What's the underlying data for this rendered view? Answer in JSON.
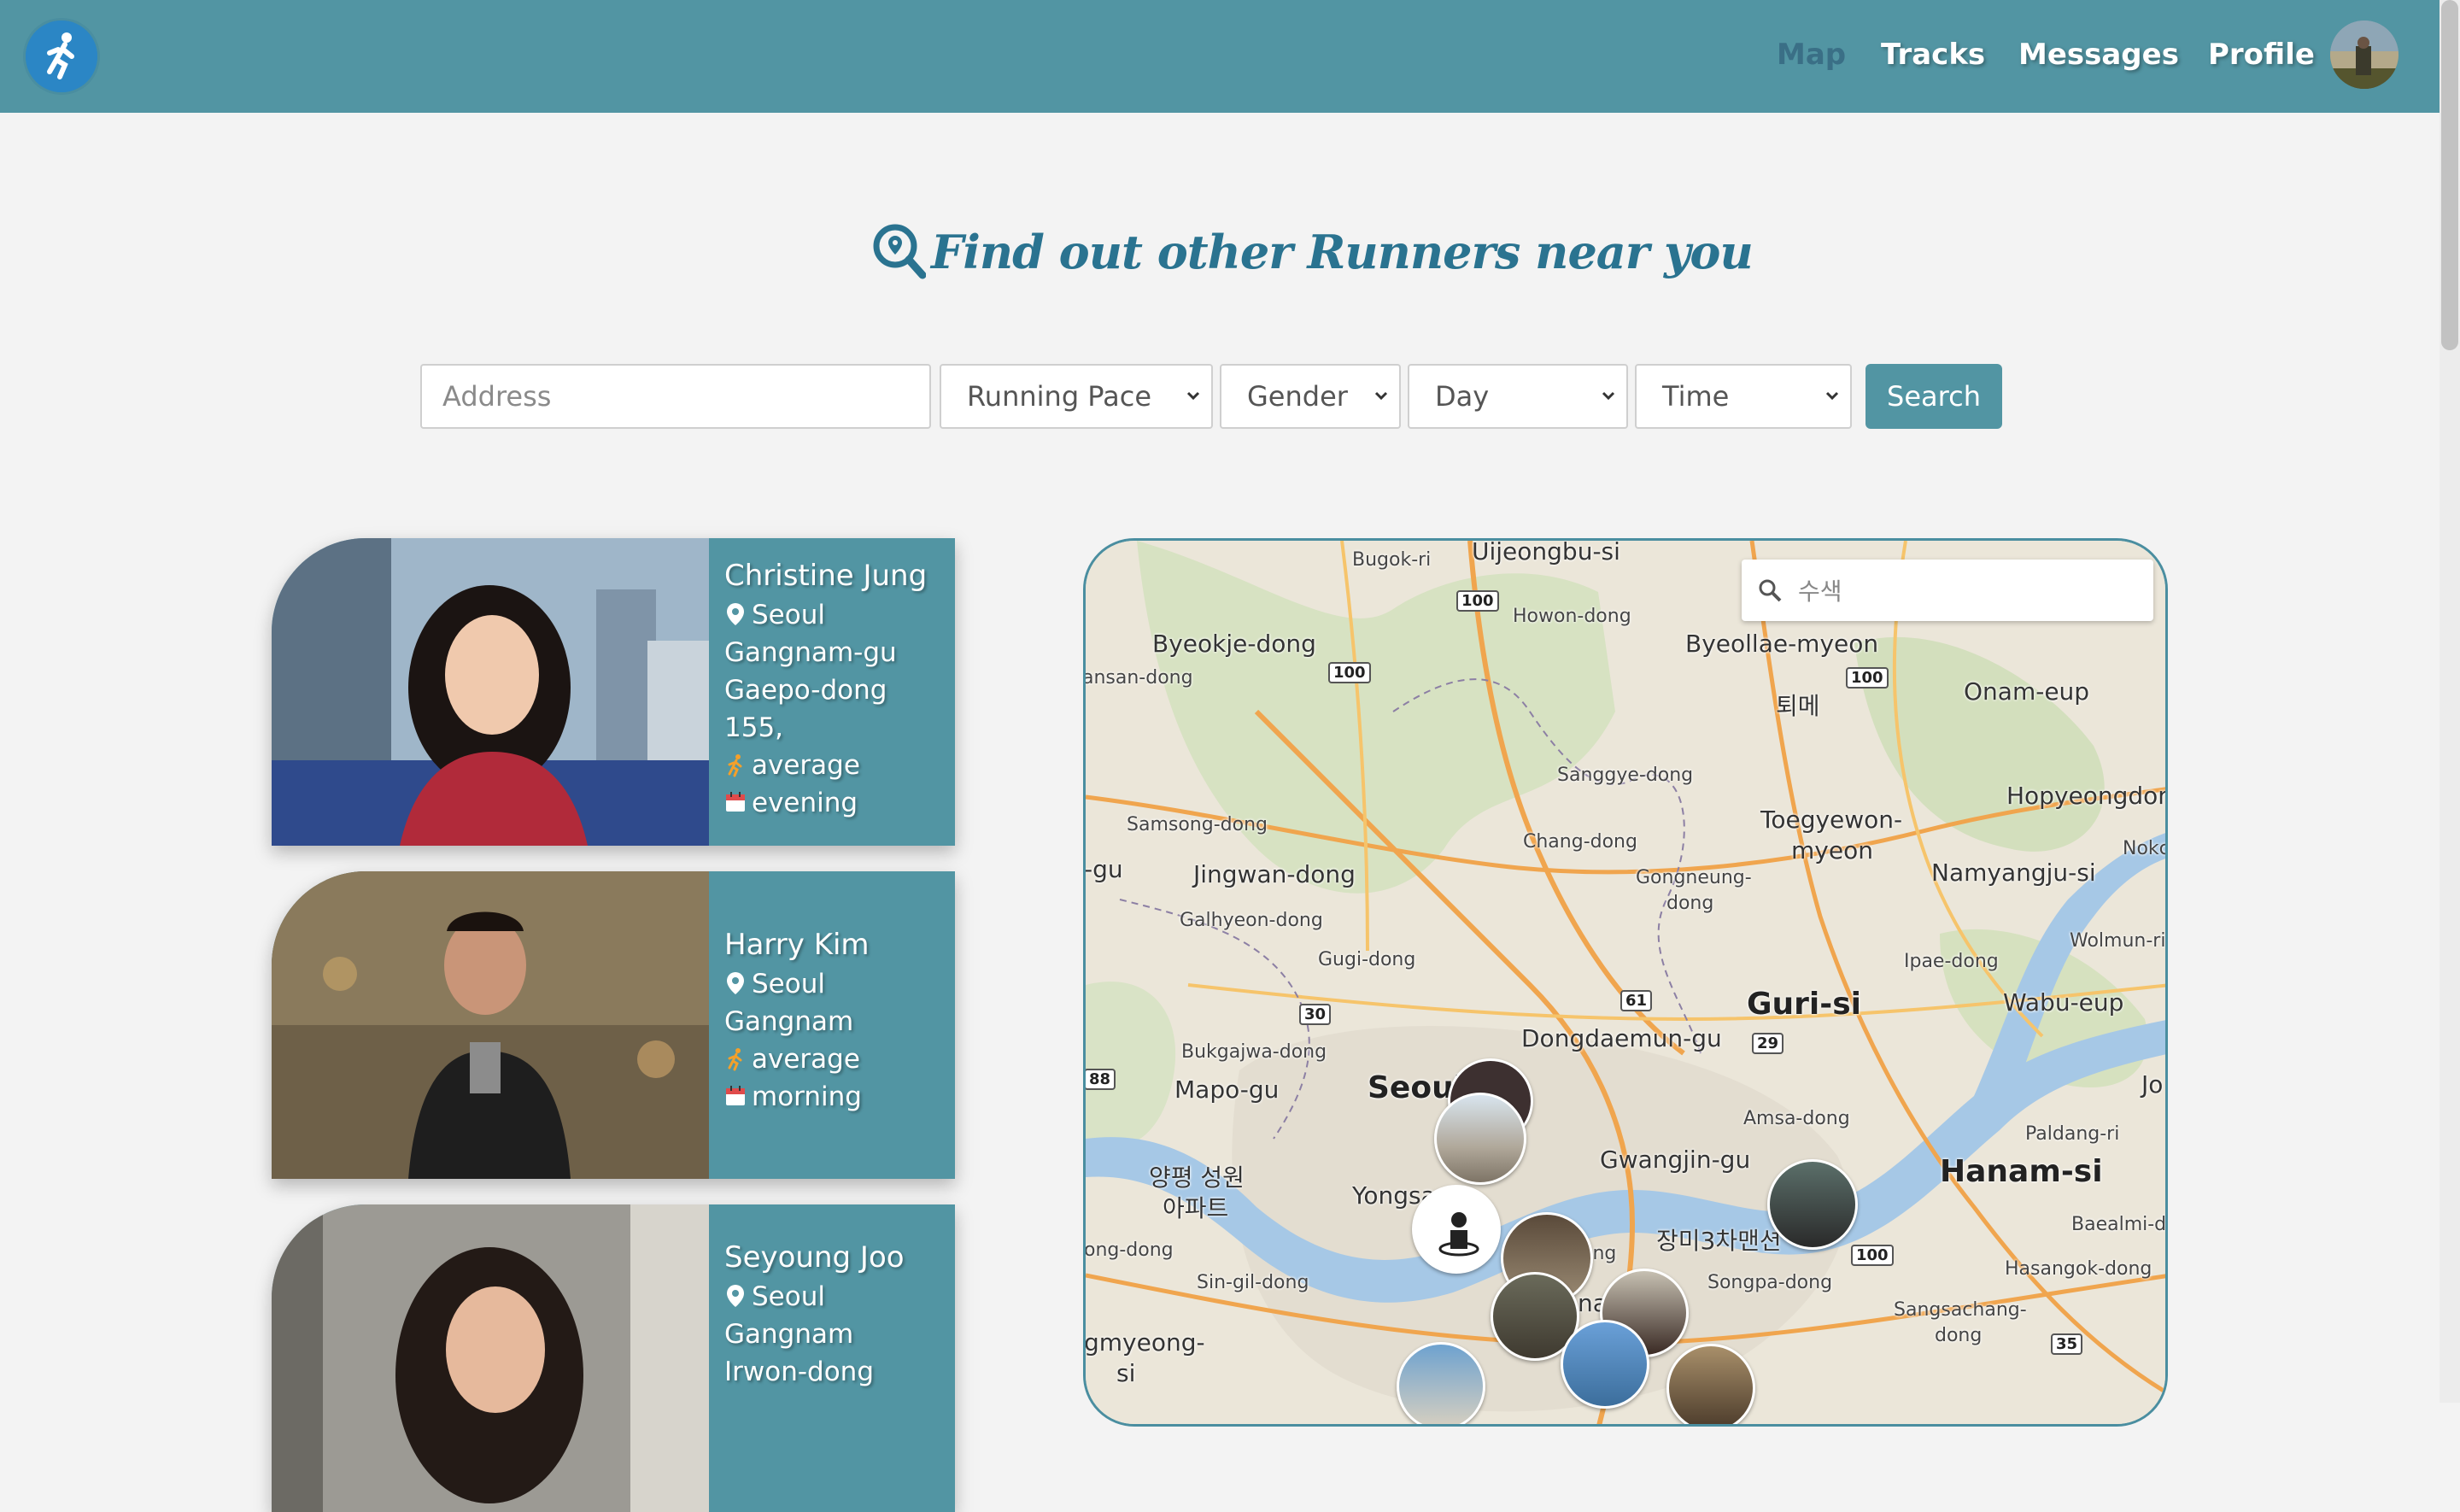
{
  "nav": {
    "logo_icon": "runner-icon",
    "links": [
      {
        "label": "Map",
        "active": true
      },
      {
        "label": "Tracks",
        "active": false
      },
      {
        "label": "Messages",
        "active": false
      },
      {
        "label": "Profile",
        "active": false
      }
    ]
  },
  "heading": {
    "icon": "search-location-icon",
    "text": "Find out other Runners near you"
  },
  "filters": {
    "address_placeholder": "Address",
    "running_pace": "Running Pace",
    "gender": "Gender",
    "day": "Day",
    "time": "Time",
    "search_label": "Search"
  },
  "runners": [
    {
      "name": "Christine Jung",
      "location_lines": [
        "Seoul",
        "Gangnam-gu",
        "Gaepo-dong",
        "155,"
      ],
      "pace": "average",
      "time": "evening"
    },
    {
      "name": "Harry Kim",
      "location_lines": [
        "Seoul",
        "Gangnam"
      ],
      "pace": "average",
      "time": "morning"
    },
    {
      "name": "Seyoung Joo",
      "location_lines": [
        "Seoul",
        "Gangnam",
        "Irwon-dong"
      ],
      "pace": "",
      "time": ""
    }
  ],
  "map": {
    "search_placeholder": "수색",
    "labels": {
      "uijeongbu": "Uijeongbu-si",
      "bugok": "Bugok-ri",
      "howon": "Howon-dong",
      "byeokje": "Byeokje-dong",
      "byeollae": "Byeollae-myeon",
      "onam": "Onam-eup",
      "toeme": "퇴메",
      "ansan": "ansan-dong",
      "sanggye": "Sanggye-dong",
      "hopyeong": "Hopyeongdong",
      "samsong": "Samsong-dong",
      "toegyewon": "Toegyewon-",
      "myeon2": "myeon",
      "chang": "Chang-dong",
      "nokch": "Nokch",
      "gu": "-gu",
      "jingwan": "Jingwan-dong",
      "gongneung": "Gongneung-",
      "dong_word": "dong",
      "namyangju": "Namyangju-si",
      "galhyeon": "Galhyeon-dong",
      "gugi": "Gugi-dong",
      "ipae": "Ipae-dong",
      "wolmun": "Wolmun-ri",
      "guri": "Guri-si",
      "wabu": "Wabu-eup",
      "bukgajwa": "Bukgajwa-dong",
      "dongdaemun": "Dongdaemun-gu",
      "mapo": "Mapo-gu",
      "seoul": "Seoul",
      "jo": "Jo",
      "amsa": "Amsa-dong",
      "paldang": "Paldang-ri",
      "yangpyeong1": "양평 성원",
      "yangpyeong2": "아파트",
      "yongsan": "Yongsa",
      "gwangjin": "Gwangjin-gu",
      "hanam": "Hanam-si",
      "jangmi": "장미3차맨션",
      "baealmi": "Baealmi-do",
      "ong_dong": "ong-dong",
      "ong": "ong",
      "sincil": "Sin-gil-dong",
      "songpa": "Songpa-dong",
      "hasangok": "Hasangok-dong",
      "sangchang": "Sangsachang-",
      "dong2": "dong",
      "gmyeong": "gmyeong-",
      "si": "si",
      "na": "na"
    },
    "roads": [
      "100",
      "100",
      "100",
      "30",
      "61",
      "29",
      "88",
      "100",
      "35"
    ]
  }
}
